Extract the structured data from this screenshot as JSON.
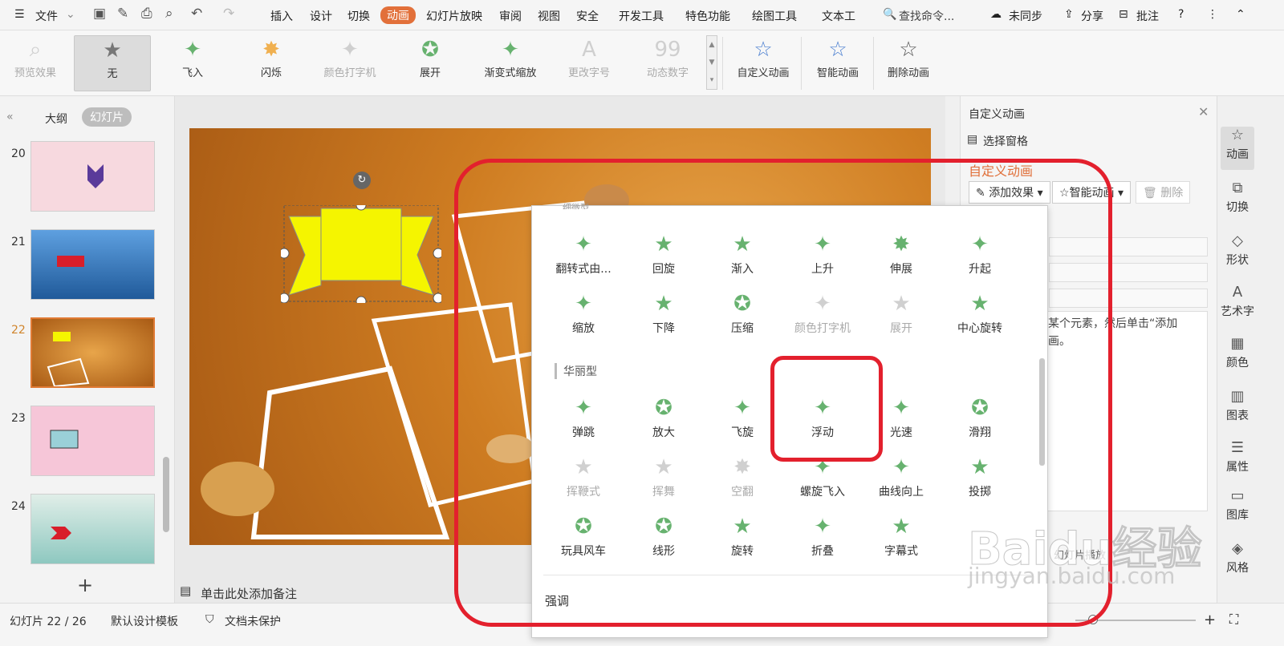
{
  "menubar": {
    "file": "文件",
    "tabs": [
      "插入",
      "设计",
      "切换",
      "动画",
      "幻灯片放映",
      "审阅",
      "视图",
      "安全",
      "开发工具",
      "特色功能",
      "绘图工具",
      "文本工"
    ],
    "search": "查找命令...",
    "sync": "未同步",
    "share": "分享",
    "comment": "批注"
  },
  "ribbon": {
    "preview": "预览效果",
    "effects": [
      {
        "label": "无",
        "icon": "star-gray"
      },
      {
        "label": "飞入",
        "icon": "fly-star"
      },
      {
        "label": "闪烁",
        "icon": "flash-star"
      },
      {
        "label": "颜色打字机",
        "icon": "type-star"
      },
      {
        "label": "展开",
        "icon": "expand-star"
      },
      {
        "label": "渐变式缩放",
        "icon": "zoom-star"
      },
      {
        "label": "更改字号",
        "icon": "font-A"
      },
      {
        "label": "动态数字",
        "icon": "digits-99"
      }
    ],
    "custom": "自定义动画",
    "smart": "智能动画",
    "delete": "删除动画"
  },
  "left": {
    "tab_outline": "大纲",
    "tab_slides": "幻灯片",
    "slides": [
      {
        "num": "20",
        "color": "#f7d9df"
      },
      {
        "num": "21",
        "color": "#3a78c0"
      },
      {
        "num": "22",
        "color": "#d0852c"
      },
      {
        "num": "23",
        "color": "#f6c6d8"
      },
      {
        "num": "24",
        "color": "#b8d8d2"
      }
    ],
    "add": "+"
  },
  "notes": "单击此处添加备注",
  "rpanel": {
    "title": "自定义动画",
    "select_pane": "选择窗格",
    "heading": "自定义动画",
    "add_effect": "添加效果",
    "smart": "智能动画",
    "delete": "删除",
    "hint1": "某个元素，然后单击“添加",
    "hint2": "画。",
    "slideshow": "幻灯片播放"
  },
  "sidebar": [
    "动画",
    "切换",
    "形状",
    "艺术字",
    "颜色",
    "图表",
    "属性",
    "图库",
    "风格"
  ],
  "status": {
    "slide": "幻灯片 22 / 26",
    "template": "默认设计模板",
    "protect": "文档未保护"
  },
  "dropdown": {
    "top_cut": "细微型",
    "row1": [
      "翻转式由...",
      "回旋",
      "渐入",
      "上升",
      "伸展",
      "升起"
    ],
    "row2": [
      "缩放",
      "下降",
      "压缩",
      "颜色打字机",
      "展开",
      "中心旋转"
    ],
    "section2": "华丽型",
    "row3": [
      "弹跳",
      "放大",
      "飞旋",
      "浮动",
      "光速",
      "滑翔"
    ],
    "row4": [
      "挥鞭式",
      "挥舞",
      "空翻",
      "螺旋飞入",
      "曲线向上",
      "投掷"
    ],
    "row5": [
      "玩具风车",
      "线形",
      "旋转",
      "折叠",
      "字幕式"
    ],
    "section3": "强调"
  },
  "watermark": {
    "main": "Baidu经验",
    "sub": "jingyan.baidu.com"
  }
}
